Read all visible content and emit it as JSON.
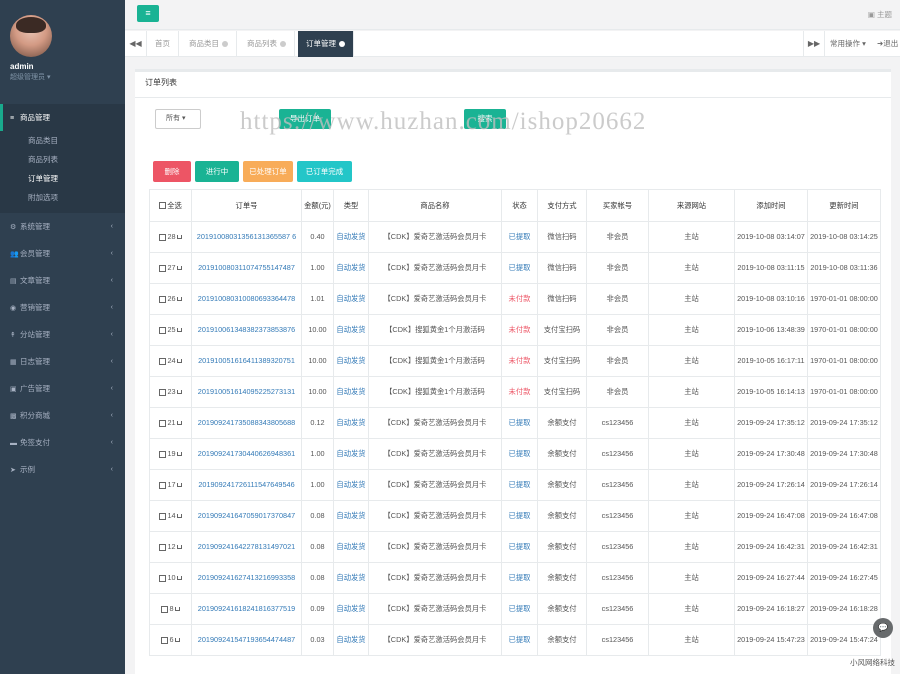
{
  "sidebar": {
    "username": "admin",
    "role": "超级管理员 ▾",
    "items": [
      {
        "label": "商品管理",
        "icon": "≡",
        "active": true
      },
      {
        "label": "系统管理",
        "icon": "⚙"
      },
      {
        "label": "会员管理",
        "icon": "👥"
      },
      {
        "label": "文章管理",
        "icon": "▤"
      },
      {
        "label": "营销管理",
        "icon": "◉"
      },
      {
        "label": "分站管理",
        "icon": "↟"
      },
      {
        "label": "日志管理",
        "icon": "▦"
      },
      {
        "label": "广告管理",
        "icon": "▣"
      },
      {
        "label": "积分商城",
        "icon": "▩"
      },
      {
        "label": "免签支付",
        "icon": "▬"
      },
      {
        "label": "示例",
        "icon": "➤"
      }
    ],
    "subitems": [
      "商品类目",
      "商品列表",
      "订单管理",
      "附加选项"
    ],
    "arrow": "‹"
  },
  "topbar": {
    "menu_icon": "≡",
    "theme": "▣ 主题"
  },
  "tabs": {
    "prev": "◀◀",
    "next": "▶▶",
    "items": [
      "首页",
      "商品类目",
      "商品列表",
      "订单管理"
    ],
    "ops": "常用操作 ▾",
    "logout": "➜退出"
  },
  "panel": {
    "title": "订单列表",
    "select": "所有 ▾",
    "export_btn": "导出订单",
    "search_btn": "搜索",
    "watermark": "https://www.huzhan.com/ishop20662"
  },
  "actions": [
    {
      "label": "删除",
      "color": "#ed5565"
    },
    {
      "label": "进行中",
      "color": "#1ab394"
    },
    {
      "label": "已处理订单",
      "color": "#f8ac59"
    },
    {
      "label": "已订单完成",
      "color": "#23c6c8"
    }
  ],
  "table": {
    "headers": [
      "全选",
      "订单号",
      "金额(元)",
      "类型",
      "商品名称",
      "状态",
      "支付方式",
      "买家帐号",
      "来源网站",
      "添加时间",
      "更新时间"
    ],
    "rows": [
      {
        "id": "28",
        "order": "20191008031356131365587 6",
        "amount": "0.40",
        "type": "自动发货",
        "name": "【CDK】爱奇艺激活码会员月卡",
        "status": "已提取",
        "pay": "微信扫码",
        "buyer": "非会员",
        "site": "主站",
        "added": "2019-10-08 03:14:07",
        "updated": "2019-10-08 03:14:25"
      },
      {
        "id": "27",
        "order": "201910080311074755147487",
        "amount": "1.00",
        "type": "自动发货",
        "name": "【CDK】爱奇艺激活码会员月卡",
        "status": "已提取",
        "pay": "微信扫码",
        "buyer": "非会员",
        "site": "主站",
        "added": "2019-10-08 03:11:15",
        "updated": "2019-10-08 03:11:36"
      },
      {
        "id": "26",
        "order": "201910080310080693364478",
        "amount": "1.01",
        "type": "自动发货",
        "name": "【CDK】爱奇艺激活码会员月卡",
        "status": "未付款",
        "pay": "微信扫码",
        "buyer": "非会员",
        "site": "主站",
        "added": "2019-10-08 03:10:16",
        "updated": "1970-01-01 08:00:00"
      },
      {
        "id": "25",
        "order": "201910061348382373853876",
        "amount": "10.00",
        "type": "自动发货",
        "name": "【CDK】搜狐黄金1个月激活码",
        "status": "未付款",
        "pay": "支付宝扫码",
        "buyer": "非会员",
        "site": "主站",
        "added": "2019-10-06 13:48:39",
        "updated": "1970-01-01 08:00:00"
      },
      {
        "id": "24",
        "order": "201910051616411389320751",
        "amount": "10.00",
        "type": "自动发货",
        "name": "【CDK】搜狐黄金1个月激活码",
        "status": "未付款",
        "pay": "支付宝扫码",
        "buyer": "非会员",
        "site": "主站",
        "added": "2019-10-05 16:17:11",
        "updated": "1970-01-01 08:00:00"
      },
      {
        "id": "23",
        "order": "201910051614095225273131",
        "amount": "10.00",
        "type": "自动发货",
        "name": "【CDK】搜狐黄金1个月激活码",
        "status": "未付款",
        "pay": "支付宝扫码",
        "buyer": "非会员",
        "site": "主站",
        "added": "2019-10-05 16:14:13",
        "updated": "1970-01-01 08:00:00"
      },
      {
        "id": "21",
        "order": "201909241735088343805688",
        "amount": "0.12",
        "type": "自动发货",
        "name": "【CDK】爱奇艺激活码会员月卡",
        "status": "已提取",
        "pay": "余额支付",
        "buyer": "cs123456",
        "site": "主站",
        "added": "2019-09-24 17:35:12",
        "updated": "2019-09-24 17:35:12"
      },
      {
        "id": "19",
        "order": "201909241730440626948361",
        "amount": "1.00",
        "type": "自动发货",
        "name": "【CDK】爱奇艺激活码会员月卡",
        "status": "已提取",
        "pay": "余额支付",
        "buyer": "cs123456",
        "site": "主站",
        "added": "2019-09-24 17:30:48",
        "updated": "2019-09-24 17:30:48"
      },
      {
        "id": "17",
        "order": "201909241726111547649546",
        "amount": "1.00",
        "type": "自动发货",
        "name": "【CDK】爱奇艺激活码会员月卡",
        "status": "已提取",
        "pay": "余额支付",
        "buyer": "cs123456",
        "site": "主站",
        "added": "2019-09-24 17:26:14",
        "updated": "2019-09-24 17:26:14"
      },
      {
        "id": "14",
        "order": "201909241647059017370847",
        "amount": "0.08",
        "type": "自动发货",
        "name": "【CDK】爱奇艺激活码会员月卡",
        "status": "已提取",
        "pay": "余额支付",
        "buyer": "cs123456",
        "site": "主站",
        "added": "2019-09-24 16:47:08",
        "updated": "2019-09-24 16:47:08"
      },
      {
        "id": "12",
        "order": "201909241642278131497021",
        "amount": "0.08",
        "type": "自动发货",
        "name": "【CDK】爱奇艺激活码会员月卡",
        "status": "已提取",
        "pay": "余额支付",
        "buyer": "cs123456",
        "site": "主站",
        "added": "2019-09-24 16:42:31",
        "updated": "2019-09-24 16:42:31"
      },
      {
        "id": "10",
        "order": "201909241627413216993358",
        "amount": "0.08",
        "type": "自动发货",
        "name": "【CDK】爱奇艺激活码会员月卡",
        "status": "已提取",
        "pay": "余额支付",
        "buyer": "cs123456",
        "site": "主站",
        "added": "2019-09-24 16:27:44",
        "updated": "2019-09-24 16:27:45"
      },
      {
        "id": "8",
        "order": "201909241618241816377519",
        "amount": "0.09",
        "type": "自动发货",
        "name": "【CDK】爱奇艺激活码会员月卡",
        "status": "已提取",
        "pay": "余额支付",
        "buyer": "cs123456",
        "site": "主站",
        "added": "2019-09-24 16:18:27",
        "updated": "2019-09-24 16:18:28"
      },
      {
        "id": "6",
        "order": "201909241547193654474487",
        "amount": "0.03",
        "type": "自动发货",
        "name": "【CDK】爱奇艺激活码会员月卡",
        "status": "已提取",
        "pay": "余额支付",
        "buyer": "cs123456",
        "site": "主站",
        "added": "2019-09-24 15:47:23",
        "updated": "2019-09-24 15:47:24"
      }
    ]
  },
  "footer": "小风网络科技",
  "float_icon": "💬"
}
